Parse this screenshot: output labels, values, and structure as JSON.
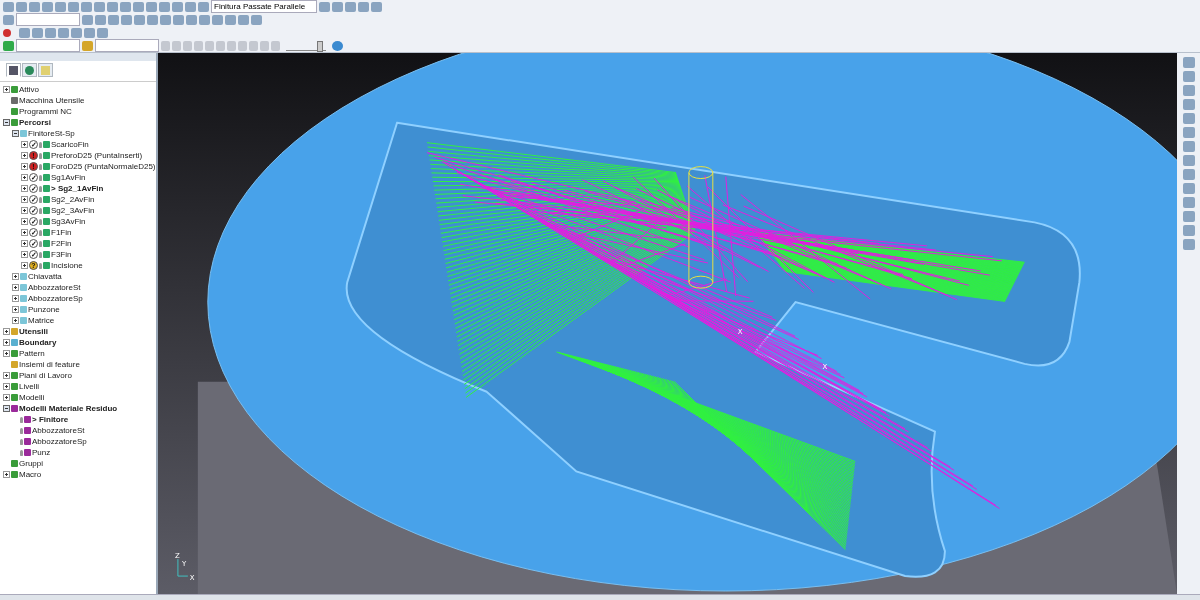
{
  "toolbar": {
    "strategy_dropdown": {
      "value": "Finitura Passate Parallele"
    },
    "speed_slider": {
      "level": 0.85
    }
  },
  "explorer": {
    "tabs": [
      {
        "selected": true
      },
      {
        "selected": false
      },
      {
        "selected": false
      }
    ],
    "tree": [
      {
        "label": "Attivo",
        "kind": "category",
        "bold": false,
        "expanded": false
      },
      {
        "label": "Macchina Utensile",
        "kind": "machine",
        "bold": false
      },
      {
        "label": "Programmi NC",
        "kind": "category",
        "bold": false
      },
      {
        "label": "Percorsi",
        "kind": "category",
        "bold": true,
        "expanded": true,
        "children": [
          {
            "label": "FinitoreSt-Sp",
            "kind": "folder",
            "bold": false,
            "expanded": true,
            "children": [
              {
                "label": "ScaricoFin",
                "kind": "toolpath",
                "status": "✓",
                "color": "#ffffff",
                "bold": false,
                "expanded": false
              },
              {
                "label": "PreforoD25 (PuntaInserti)",
                "kind": "toolpath",
                "status": "!",
                "color": "#d02020",
                "bold": false,
                "expanded": false
              },
              {
                "label": "ForoD25 (PuntaNormaleD25)",
                "kind": "toolpath",
                "status": "!",
                "color": "#d02020",
                "bold": false,
                "expanded": false
              },
              {
                "label": "Sg1AvFin",
                "kind": "toolpath",
                "status": "✓",
                "color": "#ffffff",
                "bold": false,
                "expanded": false
              },
              {
                "label": "> Sg2_1AvFin",
                "kind": "toolpath",
                "status": "✓",
                "color": "#ffffff",
                "bold": true,
                "expanded": false
              },
              {
                "label": "Sg2_2AvFin",
                "kind": "toolpath",
                "status": "✓",
                "color": "#ffffff",
                "bold": false,
                "expanded": false
              },
              {
                "label": "Sg2_3AvFin",
                "kind": "toolpath",
                "status": "✓",
                "color": "#ffffff",
                "bold": false,
                "expanded": false
              },
              {
                "label": "Sg3AvFin",
                "kind": "toolpath",
                "status": "✓",
                "color": "#ffffff",
                "bold": false,
                "expanded": false
              },
              {
                "label": "F1Fin",
                "kind": "toolpath",
                "status": "✓",
                "color": "#ffffff",
                "bold": false,
                "expanded": false
              },
              {
                "label": "F2Fin",
                "kind": "toolpath",
                "status": "✓",
                "color": "#ffffff",
                "bold": false,
                "expanded": false
              },
              {
                "label": "F3Fin",
                "kind": "toolpath",
                "status": "✓",
                "color": "#ffffff",
                "bold": false,
                "expanded": false
              },
              {
                "label": "Incisione",
                "kind": "toolpath",
                "status": "?",
                "color": "#e0b020",
                "bold": false,
                "expanded": false
              }
            ]
          },
          {
            "label": "Chiavatta",
            "kind": "folder",
            "bold": false,
            "expanded": false
          },
          {
            "label": "AbbozzatoreSt",
            "kind": "folder",
            "bold": false,
            "expanded": false
          },
          {
            "label": "AbbozzatoreSp",
            "kind": "folder",
            "bold": false,
            "expanded": false
          },
          {
            "label": "Punzone",
            "kind": "folder",
            "bold": false,
            "expanded": false
          },
          {
            "label": "Matrice",
            "kind": "folder",
            "bold": false,
            "expanded": false
          }
        ]
      },
      {
        "label": "Utensili",
        "kind": "tool",
        "bold": true,
        "expanded": false
      },
      {
        "label": "Boundary",
        "kind": "boundary",
        "bold": true,
        "expanded": false
      },
      {
        "label": "Pattern",
        "kind": "category",
        "bold": false,
        "expanded": false
      },
      {
        "label": "Insiemi di feature",
        "kind": "tool",
        "bold": false
      },
      {
        "label": "Piani di Lavoro",
        "kind": "category",
        "bold": false,
        "expanded": false
      },
      {
        "label": "Livelli",
        "kind": "category",
        "bold": false,
        "expanded": false
      },
      {
        "label": "Modelli",
        "kind": "category",
        "bold": false,
        "expanded": false
      },
      {
        "label": "Modelli Materiale Residuo",
        "kind": "residual",
        "bold": true,
        "expanded": true,
        "children": [
          {
            "label": "> Finitore",
            "kind": "residual",
            "bold": true
          },
          {
            "label": "AbbozzatoreSt",
            "kind": "residual",
            "bold": false
          },
          {
            "label": "AbbozzatoreSp",
            "kind": "residual",
            "bold": false
          },
          {
            "label": "Punz",
            "kind": "residual",
            "bold": false
          }
        ]
      },
      {
        "label": "Gruppi",
        "kind": "category",
        "bold": false
      },
      {
        "label": "Macro",
        "kind": "category",
        "bold": false,
        "expanded": false
      }
    ]
  },
  "viewport": {
    "triad_labels": [
      "Z",
      "Y",
      "X"
    ],
    "workplane_labels": [
      "X",
      "X"
    ]
  }
}
